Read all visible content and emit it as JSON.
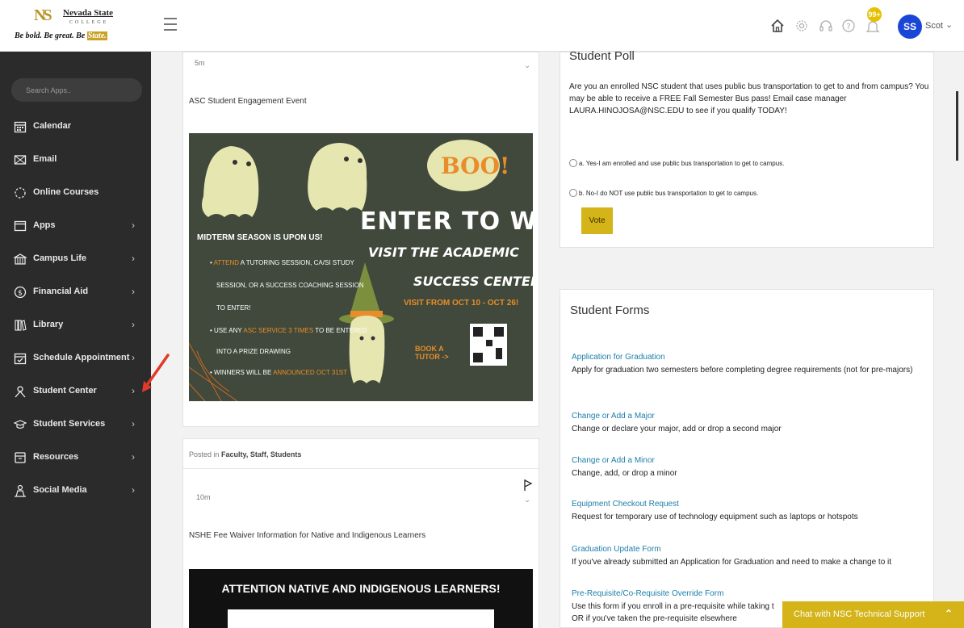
{
  "brand": {
    "logo_mark": "NS",
    "name": "Nevada State",
    "sub": "COLLEGE",
    "tagline_a": "Be bold. Be great. Be ",
    "tagline_b": "State."
  },
  "header": {
    "notifications_badge": "99+",
    "avatar_initials": "SS",
    "username": "Scot",
    "icons": [
      "home-icon",
      "gear-icon",
      "headset-icon",
      "help-icon",
      "bell-icon"
    ]
  },
  "sidebar": {
    "search_placeholder": "Search Apps..",
    "items": [
      {
        "label": "Calendar",
        "icon": "calendar-icon",
        "chevron": false
      },
      {
        "label": "Email",
        "icon": "email-icon",
        "chevron": false
      },
      {
        "label": "Online Courses",
        "icon": "online-courses-icon",
        "chevron": false
      },
      {
        "label": "Apps",
        "icon": "apps-icon",
        "chevron": true
      },
      {
        "label": "Campus Life",
        "icon": "campus-icon",
        "chevron": true
      },
      {
        "label": "Financial Aid",
        "icon": "dollar-icon",
        "chevron": true
      },
      {
        "label": "Library",
        "icon": "library-icon",
        "chevron": true
      },
      {
        "label": "Schedule Appointment",
        "icon": "schedule-icon",
        "chevron": true
      },
      {
        "label": "Student Center",
        "icon": "person-icon",
        "chevron": true
      },
      {
        "label": "Student Services",
        "icon": "services-icon",
        "chevron": true
      },
      {
        "label": "Resources",
        "icon": "resources-icon",
        "chevron": true
      },
      {
        "label": "Social Media",
        "icon": "social-icon",
        "chevron": true
      }
    ]
  },
  "feed": {
    "post1": {
      "time": "5m",
      "title": "ASC Student Engagement Event",
      "poster": {
        "boo": "BOO!",
        "enter": "ENTER TO WIN",
        "visit": "VISIT THE ACADEMIC",
        "success": "SUCCESS CENTER!",
        "dates": "VISIT FROM OCT 10 - OCT 26!",
        "midterm": "MIDTERM SEASON IS UPON US!",
        "b1a": "ATTEND",
        "b1b": " A TUTORING SESSION, CA/SI STUDY",
        "b1c": "SESSION, OR A SUCCESS COACHING SESSION",
        "b1d": "TO ENTER!",
        "b2a": "USE ANY ",
        "b2b": "ASC SERVICE 3 TIMES",
        "b2c": " TO BE ENTERED",
        "b2d": "INTO A PRIZE DRAWING",
        "b3a": "WINNERS WILL BE ",
        "b3b": "ANNOUNCED OCT 31ST",
        "book1": "BOOK A",
        "book2": "TUTOR ->"
      }
    },
    "post2": {
      "posted_label": "Posted in ",
      "posted_in": "Faculty, Staff, Students",
      "time": "10m",
      "title": "NSHE Fee Waiver Information for Native and Indigenous Learners",
      "poster_title": "ATTENTION NATIVE AND INDIGENOUS LEARNERS!"
    }
  },
  "poll": {
    "title": "Student Poll",
    "question": "Are you an enrolled NSC student that uses public bus transportation to get to and from campus? You may be able to receive a FREE Fall Semester Bus pass! Email case manager LAURA.HINOJOSA@NSC.EDU to see if you qualify TODAY!",
    "option_a_prefix": "a.",
    "option_a": "Yes-I am enrolled and use public bus transportation to get to campus.",
    "option_b_prefix": "b.",
    "option_b": "No-I do NOT use public bus transportation to get to campus.",
    "vote_label": "Vote"
  },
  "forms": {
    "title": "Student Forms",
    "items": [
      {
        "link": "Application for Graduation",
        "desc": "Apply for graduation two semesters before completing degree requirements (not for pre-majors)"
      },
      {
        "link": "Change or Add a Major",
        "desc": "Change or declare your major, add or drop a second major"
      },
      {
        "link": "Change or Add a Minor",
        "desc": "Change, add, or drop a minor"
      },
      {
        "link": "Equipment Checkout Request",
        "desc": "Request for temporary use of technology equipment such as laptops or hotspots"
      },
      {
        "link": "Graduation Update Form",
        "desc": "If you've already submitted an Application for Graduation and need to make a change to it"
      },
      {
        "link": "Pre-Requisite/Co-Requisite Override Form",
        "desc": "Use this form if you enroll in a pre-requisite while taking t",
        "desc2": "OR if you've taken the pre-requisite elsewhere"
      }
    ]
  },
  "chat": {
    "label": "Chat with NSC Technical Support"
  },
  "colors": {
    "sidebar": "#2b2b2b",
    "accent_gold": "#d4b419",
    "link": "#1d7fa8",
    "avatar": "#1a46d8"
  }
}
